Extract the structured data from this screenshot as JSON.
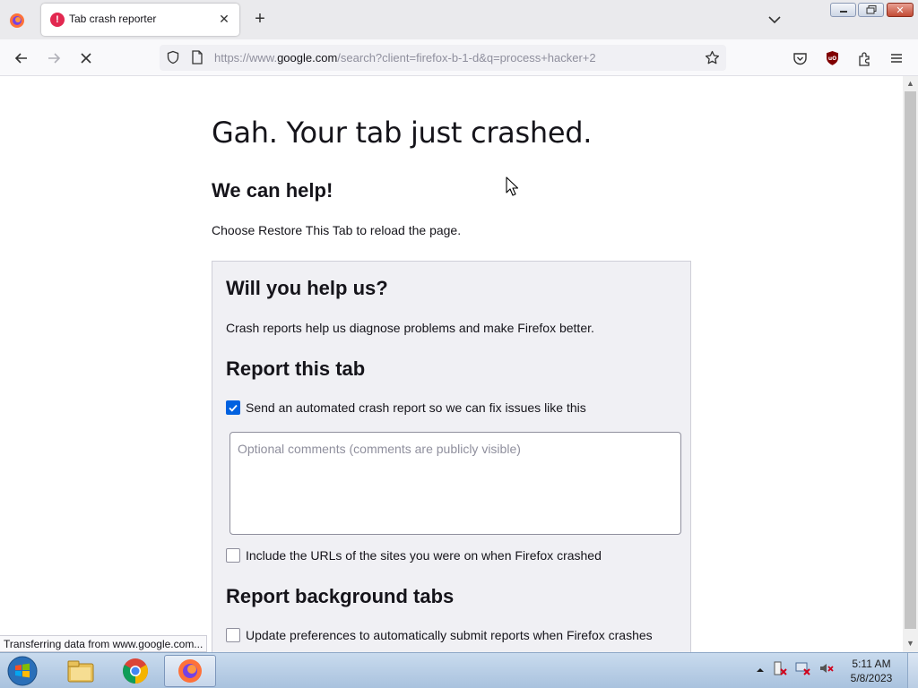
{
  "browser": {
    "tab": {
      "title": "Tab crash reporter",
      "icon": "error-icon"
    },
    "url": {
      "prefix": "https://www.",
      "host": "google.com",
      "path": "/search?client=firefox-b-1-d&q=process+hacker+2"
    }
  },
  "page": {
    "title": "Gah. Your tab just crashed.",
    "help_heading": "We can help!",
    "help_text": "Choose Restore This Tab to reload the page.",
    "report": {
      "heading": "Will you help us?",
      "intro": "Crash reports help us diagnose problems and make Firefox better.",
      "report_tab_heading": "Report this tab",
      "send_report_label": "Send an automated crash report so we can fix issues like this",
      "send_report_checked": true,
      "comments_placeholder": "Optional comments (comments are publicly visible)",
      "include_urls_label": "Include the URLs of the sites you were on when Firefox crashed",
      "include_urls_checked": false,
      "background_heading": "Report background tabs",
      "auto_submit_label": "Update preferences to automatically submit reports when Firefox crashes",
      "auto_submit_checked": false
    }
  },
  "status_bar": "Transferring data from www.google.com...",
  "taskbar": {
    "time": "5:11 AM",
    "date": "5/8/2023",
    "apps": [
      "windows-explorer",
      "google-chrome",
      "firefox"
    ]
  },
  "colors": {
    "accent": "#0061e0",
    "error": "#e22850"
  }
}
